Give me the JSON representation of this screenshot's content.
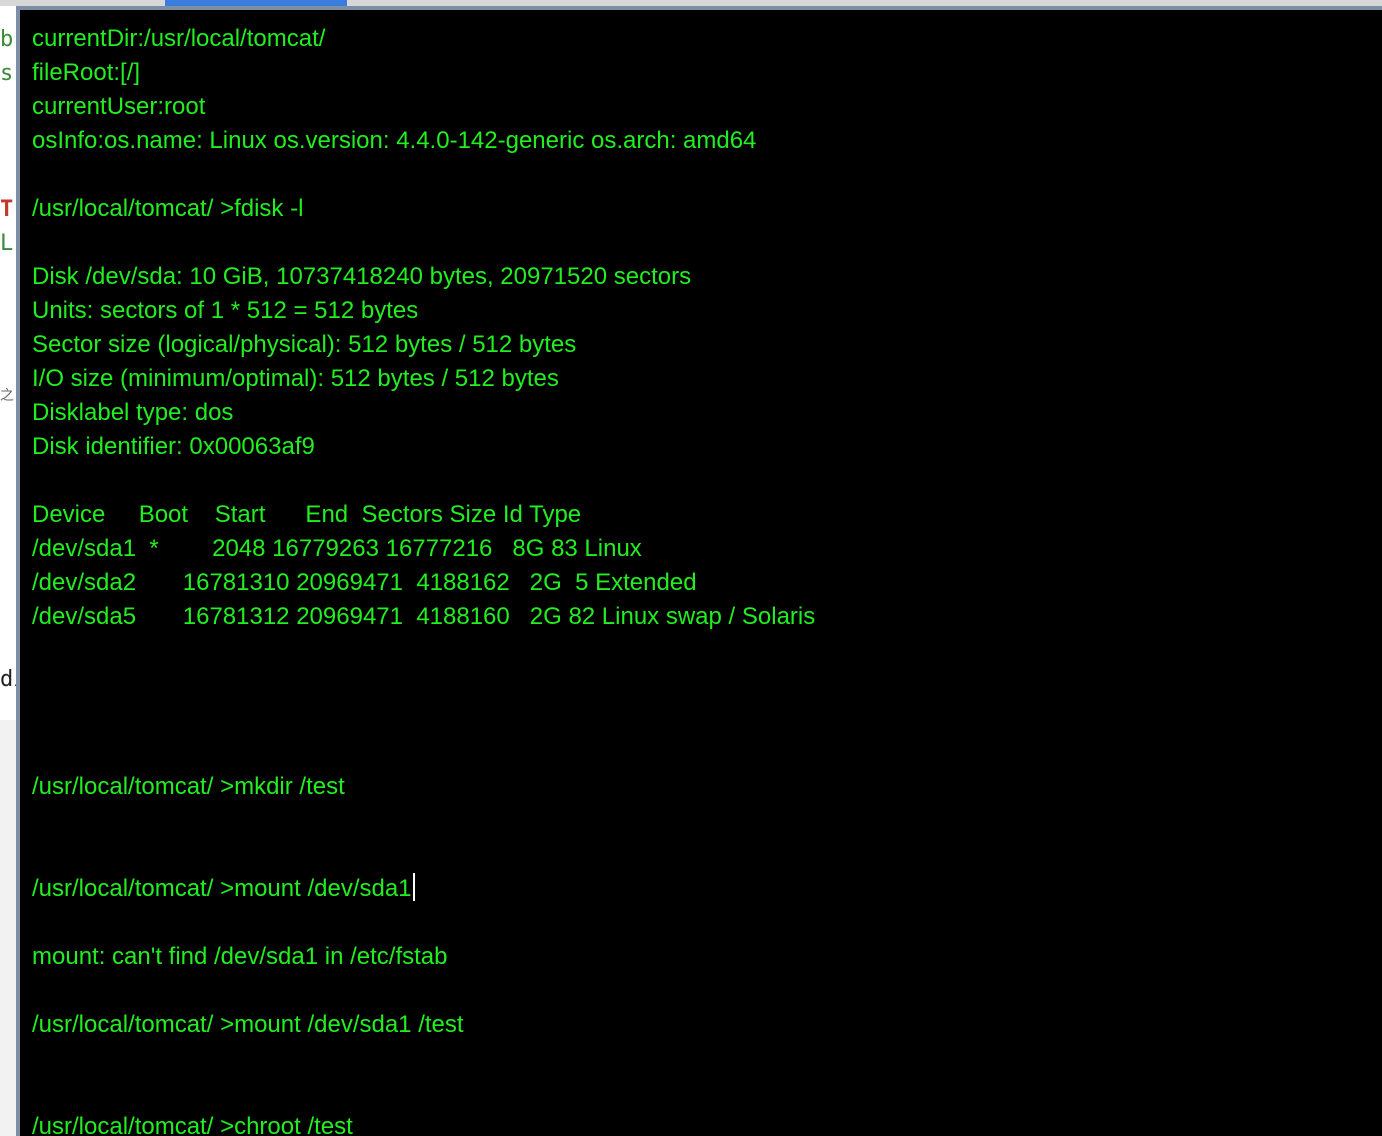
{
  "background_window": {
    "fragments": [
      {
        "text": "b",
        "color": "#3a8a3a"
      },
      {
        "text": "s",
        "color": "#3a8a3a"
      },
      {
        "text": "T",
        "color": "#c0392b"
      },
      {
        "text": "L",
        "color": "#3a8a3a"
      },
      {
        "text": "之",
        "color": "#666666"
      },
      {
        "text": "di",
        "color": "#222222"
      }
    ]
  },
  "terminal": {
    "text_color": "#22ee22",
    "background": "#000000",
    "lines": [
      "currentDir:/usr/local/tomcat/",
      "fileRoot:[/]",
      "currentUser:root",
      "osInfo:os.name: Linux os.version: 4.4.0-142-generic os.arch: amd64",
      "",
      "/usr/local/tomcat/ >fdisk -l",
      "",
      "Disk /dev/sda: 10 GiB, 10737418240 bytes, 20971520 sectors",
      "Units: sectors of 1 * 512 = 512 bytes",
      "Sector size (logical/physical): 512 bytes / 512 bytes",
      "I/O size (minimum/optimal): 512 bytes / 512 bytes",
      "Disklabel type: dos",
      "Disk identifier: 0x00063af9",
      "",
      "Device     Boot    Start      End  Sectors Size Id Type",
      "/dev/sda1  *        2048 16779263 16777216   8G 83 Linux",
      "/dev/sda2       16781310 20969471  4188162   2G  5 Extended",
      "/dev/sda5       16781312 20969471  4188160   2G 82 Linux swap / Solaris",
      "",
      "",
      "",
      "",
      "/usr/local/tomcat/ >mkdir /test",
      "",
      "",
      "/usr/local/tomcat/ >mount /dev/sda1",
      "",
      "mount: can't find /dev/sda1 in /etc/fstab",
      "",
      "/usr/local/tomcat/ >mount /dev/sda1 /test",
      "",
      "",
      "/usr/local/tomcat/ >chroot /test"
    ],
    "cursor_line": 25
  }
}
